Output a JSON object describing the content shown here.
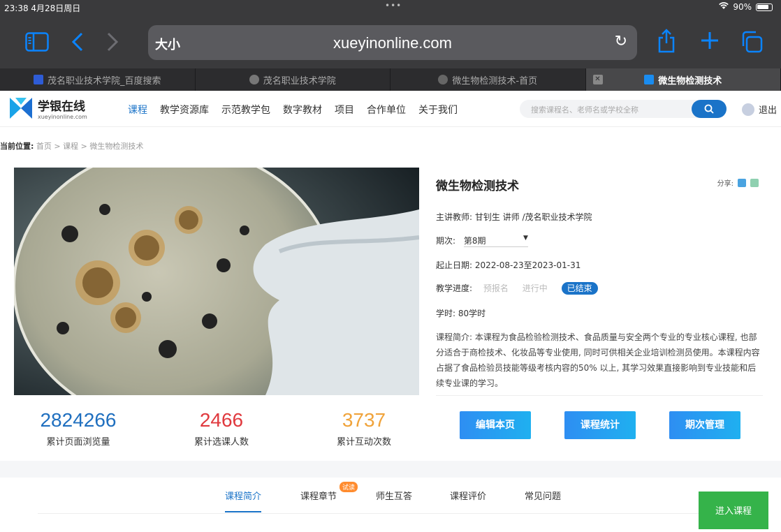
{
  "status": {
    "time": "23:38  4月28日周日",
    "battery": "90%"
  },
  "browser": {
    "reader_label": "大小",
    "url": "xueyinonline.com",
    "tabs": [
      {
        "label": "茂名职业技术学院_百度搜索"
      },
      {
        "label": "茂名职业技术学院"
      },
      {
        "label": "微生物检测技术-首页"
      },
      {
        "label": "微生物检测技术"
      }
    ]
  },
  "site": {
    "logo_name": "学银在线",
    "logo_domain": "xueyinonline.com",
    "nav": [
      "课程",
      "教学资源库",
      "示范教学包",
      "数字教材",
      "项目",
      "合作单位",
      "关于我们"
    ],
    "search_placeholder": "搜索课程名、老师名或学校全称",
    "logout": "退出"
  },
  "breadcrumb": {
    "prefix": "当前位置:",
    "path": "首页 > 课程 > 微生物检测技术"
  },
  "course": {
    "title": "微生物检测技术",
    "share_label": "分享:",
    "teacher": "主讲教师: 甘钊生 讲师 /茂名职业技术学院",
    "period_label": "期次:",
    "period_value": "第8期",
    "dates": "起止日期: 2022-08-23至2023-01-31",
    "progress_label": "教学进度:",
    "progress_steps": [
      "预报名",
      "进行中",
      "已结束"
    ],
    "hours": "学时: 80学时",
    "description": "课程简介: 本课程为食品检验检测技术、食品质量与安全两个专业的专业核心课程, 也部分适合于商检技术、化妆品等专业使用, 同时可供相关企业培训检测员使用。本课程内容占据了食品检验员技能等级考核内容的50% 以上, 其学习效果直接影响到专业技能和后续专业课的学习。"
  },
  "stats": [
    {
      "value": "2824266",
      "label": "累计页面浏览量",
      "color": "#1f6fbf"
    },
    {
      "value": "2466",
      "label": "累计选课人数",
      "color": "#e0393e"
    },
    {
      "value": "3737",
      "label": "累计互动次数",
      "color": "#f0a33a"
    }
  ],
  "actions": [
    "编辑本页",
    "课程统计",
    "期次管理"
  ],
  "content_tabs": [
    "课程简介",
    "课程章节",
    "师生互答",
    "课程评价",
    "常见问题"
  ],
  "trial_badge": "试读",
  "enter_course": "进入课程"
}
